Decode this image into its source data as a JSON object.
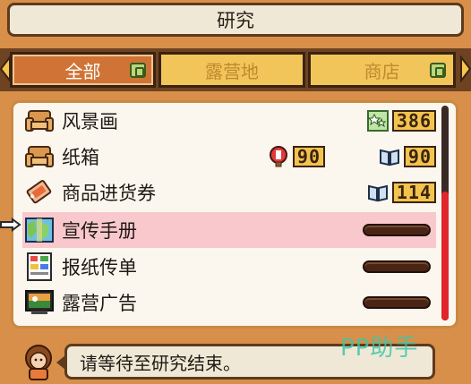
{
  "header": {
    "title": "研究"
  },
  "tabs": [
    {
      "label": "全部",
      "active": true
    },
    {
      "label": "露营地",
      "active": false
    },
    {
      "label": "商店",
      "active": false
    }
  ],
  "items": [
    {
      "name": "风景画",
      "icon": "armchair-icon",
      "costs": [
        {
          "icon": "sparkle-points-icon",
          "value": "386"
        }
      ]
    },
    {
      "name": "纸箱",
      "icon": "armchair-icon",
      "costs": [
        {
          "icon": "balloon-icon",
          "value": "90"
        },
        {
          "icon": "book-icon",
          "value": "90"
        }
      ]
    },
    {
      "name": "商品进货券",
      "icon": "ticket-icon",
      "costs": [
        {
          "icon": "book-icon",
          "value": "114"
        }
      ]
    },
    {
      "name": "宣传手册",
      "icon": "map-brochure-icon",
      "selected": true,
      "progress": 0
    },
    {
      "name": "报纸传单",
      "icon": "newspaper-icon",
      "progress": 0
    },
    {
      "name": "露营广告",
      "icon": "tv-ad-icon",
      "progress": 0
    }
  ],
  "scrollbar": {
    "position_fraction": 0.4
  },
  "message": {
    "text": "请等待至研究结束。"
  },
  "watermark": "PP助手",
  "colors": {
    "background": "#d88f4a",
    "selected_row": "#f9c8cc",
    "number_badge": "#f2c34e",
    "scroll_thumb": "#e0262a"
  }
}
